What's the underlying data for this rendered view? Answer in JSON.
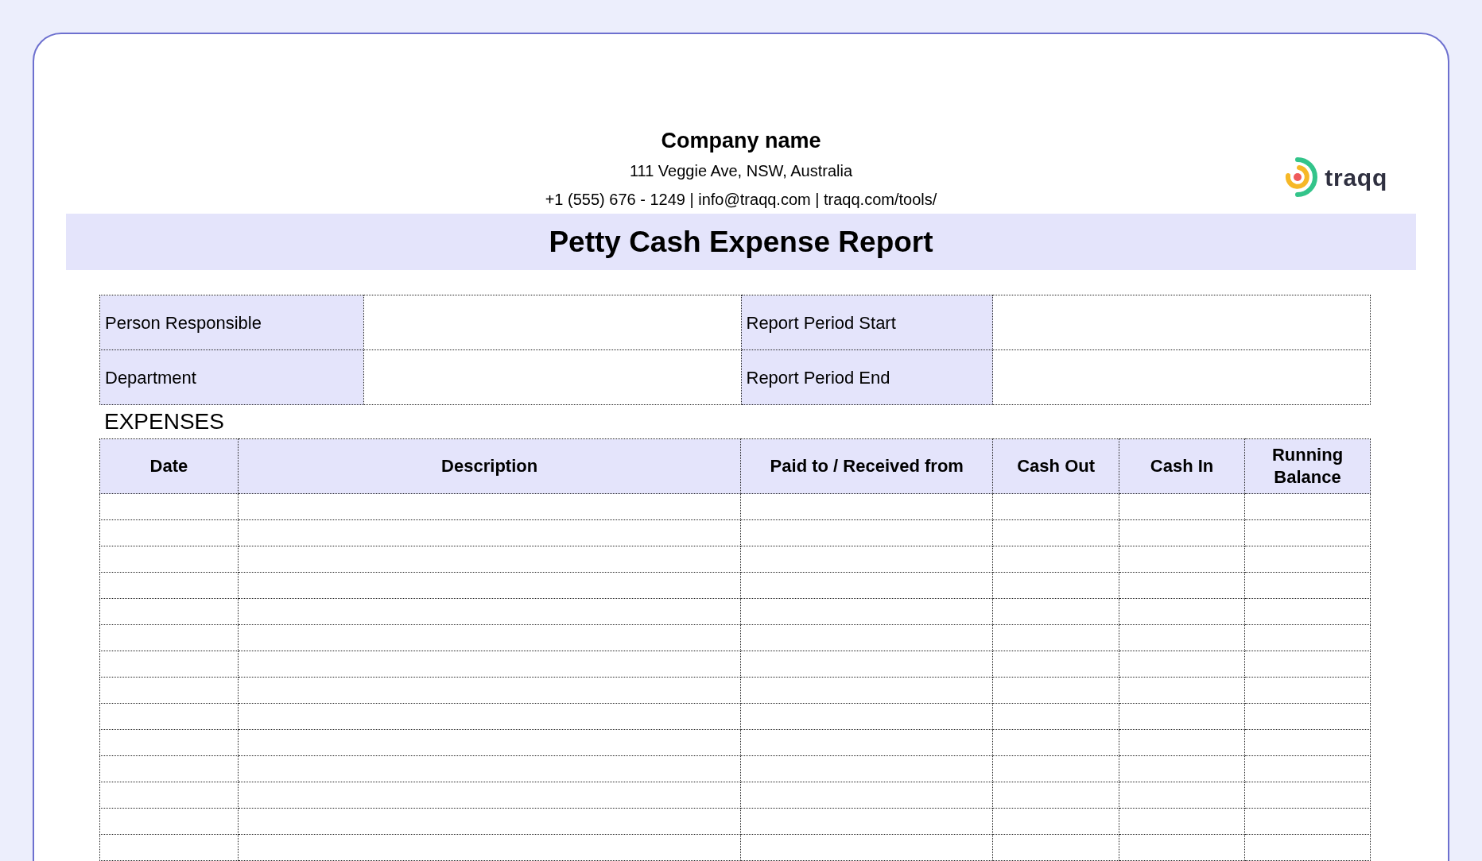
{
  "header": {
    "company": "Company name",
    "address": "111 Veggie Ave, NSW, Australia",
    "contact": "+1 (555) 676 - 1249 | info@traqq.com | traqq.com/tools/",
    "logo_text": "traqq"
  },
  "title": "Petty Cash Expense Report",
  "info_fields": [
    {
      "label": "Person Responsible"
    },
    {
      "label": "Report Period Start"
    },
    {
      "label": "Department"
    },
    {
      "label": "Report Period End"
    }
  ],
  "expenses": {
    "heading": "EXPENSES",
    "columns": [
      "Date",
      "Description",
      "Paid to / Received from",
      "Cash Out",
      "Cash In",
      "Running Balance"
    ]
  }
}
